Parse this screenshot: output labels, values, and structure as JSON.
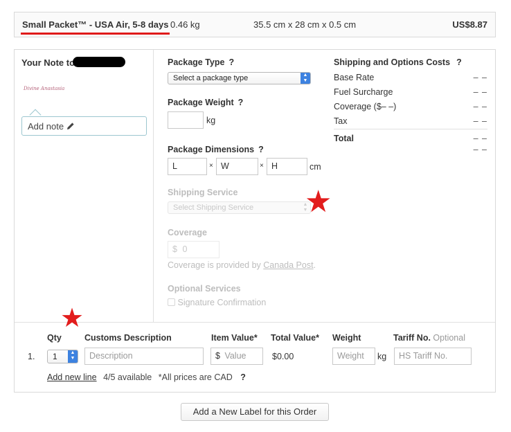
{
  "service": {
    "name": "Small Packet™ - USA Air, 5-8 days",
    "weight": "0.46 kg",
    "dimensions": "35.5 cm x 28 cm x 0.5 cm",
    "price": "US$8.87",
    "highlight_color": "#e01a1a"
  },
  "note": {
    "title": "Your Note to",
    "logo_text": "Divine Anastasia",
    "add_note_label": "Add note",
    "edit_icon": "pencil-icon"
  },
  "package": {
    "type_label": "Package Type",
    "type_select": "Select a package type",
    "weight_label": "Package Weight",
    "weight_unit": "kg",
    "dimensions_label": "Package Dimensions",
    "dim_l": "L",
    "dim_w": "W",
    "dim_h": "H",
    "dim_sep": "×",
    "dim_unit": "cm",
    "service_label": "Shipping Service",
    "service_select": "Select Shipping Service",
    "coverage_label": "Coverage",
    "coverage_currency": "$",
    "coverage_value": "0",
    "coverage_note": "Coverage is provided by",
    "coverage_link": "Canada Post",
    "coverage_period": ".",
    "optional_label": "Optional Services",
    "signature_label": "Signature Confirmation",
    "help": "?"
  },
  "costs": {
    "title": "Shipping and Options Costs",
    "rows": [
      {
        "label": "Base Rate",
        "value": "– –"
      },
      {
        "label": "Fuel Surcharge",
        "value": "– –"
      },
      {
        "label": "Coverage ($– –)",
        "value": "– –"
      },
      {
        "label": "Tax",
        "value": "– –"
      }
    ],
    "total_label": "Total",
    "total_value": "– –",
    "total_value2": "– –"
  },
  "customs": {
    "headers": {
      "qty": "Qty",
      "description": "Customs Description",
      "item_value": "Item Value*",
      "total_value": "Total Value*",
      "weight": "Weight",
      "tariff": "Tariff No.",
      "tariff_optional": "Optional"
    },
    "row": {
      "index": "1.",
      "qty": "1",
      "description_placeholder": "Description",
      "value_currency": "$",
      "value_placeholder": "Value",
      "total": "$0.00",
      "weight_placeholder": "Weight",
      "weight_unit": "kg",
      "tariff_placeholder": "HS Tariff No."
    },
    "add_line": "Add new line",
    "available": "4/5 available",
    "prices_note": "*All prices are CAD",
    "help": "?"
  },
  "add_label_button": "Add a New Label for this Order",
  "annotation_star": "★"
}
